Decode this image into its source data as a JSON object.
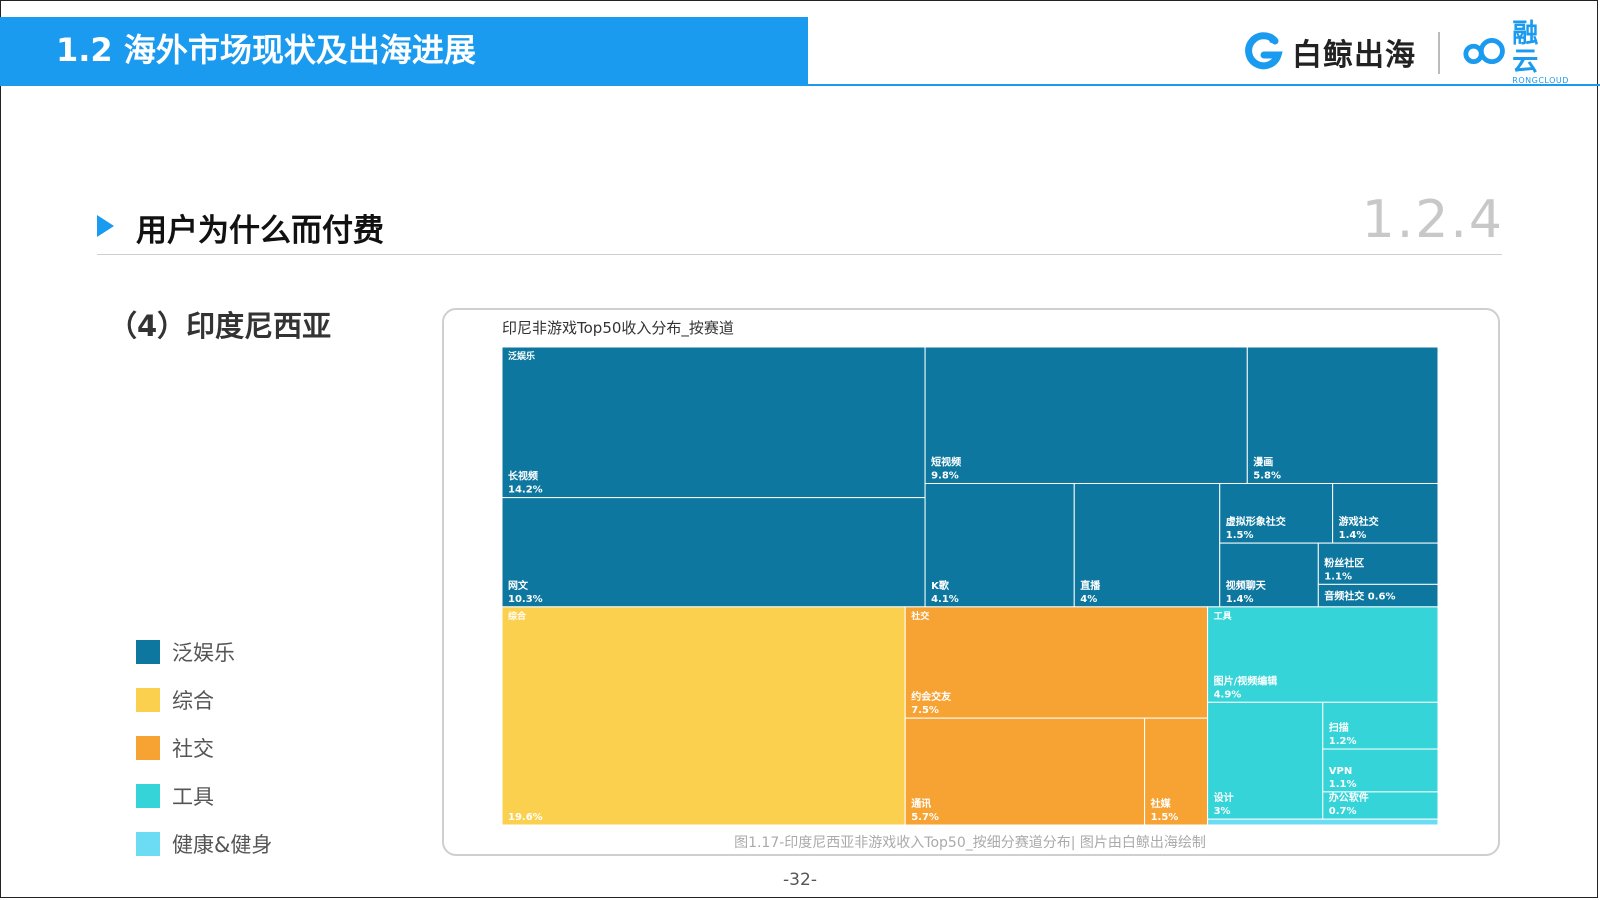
{
  "header": {
    "title": "1.2 海外市场现状及出海进展"
  },
  "brand": {
    "baijing": "白鲸出海",
    "rongyun": "融 云",
    "rongyun_sub": "RONGCLOUD"
  },
  "section": {
    "title": "用户为什么而付费",
    "number": "1.2.4"
  },
  "subsection": {
    "title": "（4）印度尼西亚"
  },
  "legend": [
    {
      "label": "泛娱乐",
      "color": "#0d779f"
    },
    {
      "label": "综合",
      "color": "#fcd04f"
    },
    {
      "label": "社交",
      "color": "#f7a334"
    },
    {
      "label": "工具",
      "color": "#35d4d8"
    },
    {
      "label": "健康&健身",
      "color": "#6cdcf5"
    }
  ],
  "chart_data": {
    "type": "treemap",
    "title": "印尼非游戏Top50收入分布_按赛道",
    "groups": [
      {
        "name": "泛娱乐",
        "color": "#0d779f",
        "children": [
          {
            "name": "长视频",
            "value": 14.2,
            "label": "14.2%"
          },
          {
            "name": "网文",
            "value": 10.3,
            "label": "10.3%"
          },
          {
            "name": "短视频",
            "value": 9.8,
            "label": "9.8%"
          },
          {
            "name": "漫画",
            "value": 5.8,
            "label": "5.8%"
          },
          {
            "name": "K歌",
            "value": 4.1,
            "label": "4.1%"
          },
          {
            "name": "直播",
            "value": 4,
            "label": "4%"
          },
          {
            "name": "虚拟形象社交",
            "value": 1.5,
            "label": "1.5%"
          },
          {
            "name": "游戏社交",
            "value": 1.4,
            "label": "1.4%"
          },
          {
            "name": "视频聊天",
            "value": 1.4,
            "label": "1.4%"
          },
          {
            "name": "粉丝社区",
            "value": 1.1,
            "label": "1.1%"
          },
          {
            "name": "音频社交",
            "value": 0.6,
            "label": "0.6%"
          }
        ]
      },
      {
        "name": "综合",
        "color": "#fcd04f",
        "children": [
          {
            "name": "",
            "value": 19.6,
            "label": "19.6%"
          }
        ]
      },
      {
        "name": "社交",
        "color": "#f7a334",
        "children": [
          {
            "name": "约会交友",
            "value": 7.5,
            "label": "7.5%"
          },
          {
            "name": "通讯",
            "value": 5.7,
            "label": "5.7%"
          },
          {
            "name": "社媒",
            "value": 1.5,
            "label": "1.5%"
          }
        ]
      },
      {
        "name": "工具",
        "color": "#35d4d8",
        "children": [
          {
            "name": "图片/视频编辑",
            "value": 4.9,
            "label": "4.9%"
          },
          {
            "name": "设计",
            "value": 3,
            "label": "3%"
          },
          {
            "name": "扫描",
            "value": 1.2,
            "label": "1.2%"
          },
          {
            "name": "VPN",
            "value": 1.1,
            "label": "1.1%"
          },
          {
            "name": "办公软件",
            "value": 0.7,
            "label": "0.7%"
          }
        ]
      },
      {
        "name": "健康&健身",
        "color": "#6cdcf5",
        "children": [
          {
            "name": "",
            "value": 0.3,
            "label": ""
          }
        ]
      }
    ]
  },
  "caption": "图1.17-印度尼西亚非游戏收入Top50_按细分赛道分布| 图片由白鲸出海绘制",
  "page": "-32-"
}
